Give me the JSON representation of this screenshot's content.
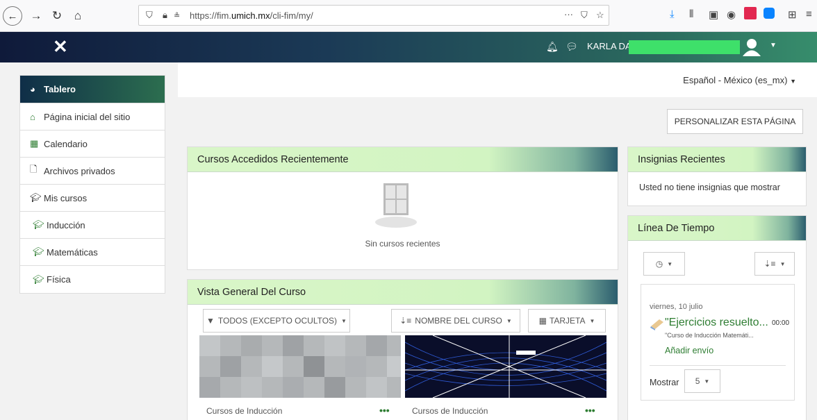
{
  "browser": {
    "url_prefix": "https://fim.",
    "url_domain": "umich.mx",
    "url_path": "/cli-fim/my/",
    "menu_dots": "···"
  },
  "navbar": {
    "user_name": "KARLA DA"
  },
  "sidebar": {
    "items": [
      {
        "label": "Tablero",
        "icon": "dashboard-icon"
      },
      {
        "label": "Página inicial del sitio",
        "icon": "home-icon"
      },
      {
        "label": "Calendario",
        "icon": "calendar-icon"
      },
      {
        "label": "Archivos privados",
        "icon": "file-icon"
      },
      {
        "label": "Mis cursos",
        "icon": "graduation-cap-icon"
      },
      {
        "label": "Inducción",
        "icon": "graduation-cap-icon"
      },
      {
        "label": "Matemáticas",
        "icon": "graduation-cap-icon"
      },
      {
        "label": "Física",
        "icon": "graduation-cap-icon"
      }
    ]
  },
  "header": {
    "language": "Español - México (es_mx)",
    "customize_label": "PERSONALIZAR ESTA PÁGINA"
  },
  "recent_courses": {
    "title": "Cursos Accedidos Recientemente",
    "empty_text": "Sin cursos recientes"
  },
  "course_overview": {
    "title": "Vista General Del Curso",
    "filter_label": "TODOS (EXCEPTO OCULTOS)",
    "sort_label": "NOMBRE DEL CURSO",
    "view_label": "TARJETA",
    "courses": [
      {
        "label": "Cursos de Inducción"
      },
      {
        "label": "Cursos de Inducción"
      }
    ]
  },
  "badges": {
    "title": "Insignias Recientes",
    "empty_text": "Usted no tiene insignias que mostrar"
  },
  "timeline": {
    "title": "Línea De Tiempo",
    "date": "viernes, 10 julio",
    "event_title": "\"Ejercicios resuelto...",
    "event_time": "00:00",
    "event_course": "\"Curso de Inducción Matemáti...",
    "action_label": "Añadir envío",
    "show_label": "Mostrar",
    "show_value": "5"
  }
}
